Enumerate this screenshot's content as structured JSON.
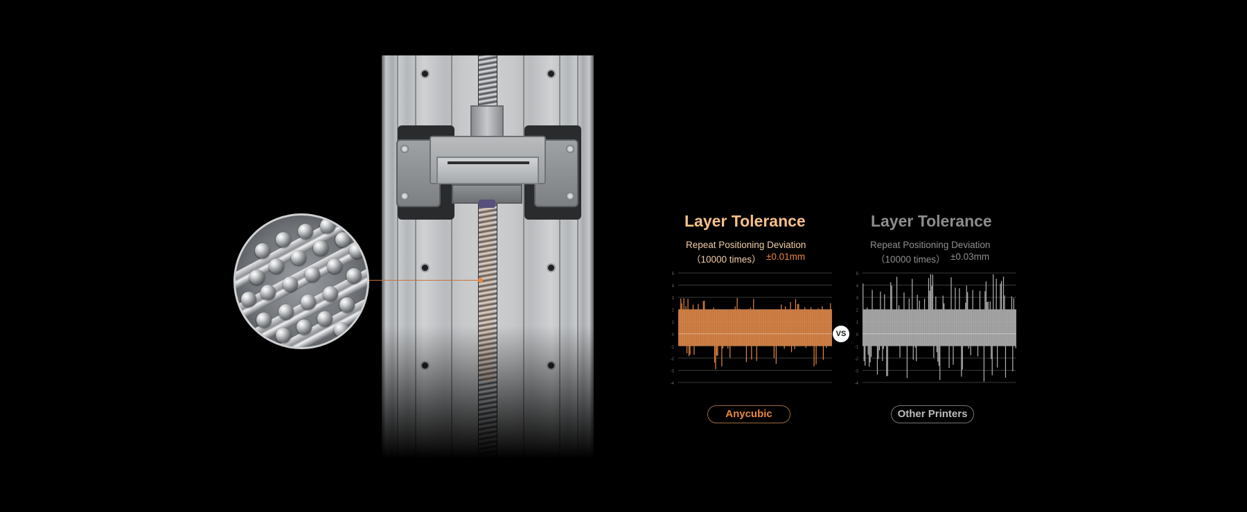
{
  "colors": {
    "background": "#000000",
    "accent": "#e9863d",
    "accent_light": "#f6b56f",
    "gray": "#a8a8a8",
    "gray_light": "#cfcfcf"
  },
  "comparison": {
    "vs_label": "VS"
  },
  "chart_data": [
    {
      "type": "bar",
      "title": "Layer Tolerance",
      "subtitle": "Repeat Positioning Deviation",
      "subtitle_note": "（10000 times）",
      "deviation_value": "±0.01mm",
      "legend_label": "Anycubic",
      "ylim": [
        -4,
        5
      ],
      "yticks": [
        5,
        4,
        3,
        2,
        1,
        0,
        -1,
        -2,
        -3,
        -4
      ],
      "baseline": 0,
      "band": [
        -1,
        2
      ],
      "grid": true,
      "sample_count": 150,
      "color": "#e9863d"
    },
    {
      "type": "bar",
      "title": "Layer Tolerance",
      "subtitle": "Repeat Positioning Deviation",
      "subtitle_note": "（10000 times）",
      "deviation_value": "±0.03mm",
      "legend_label": "Other Printers",
      "ylim": [
        -4,
        5
      ],
      "yticks": [
        5,
        4,
        3,
        2,
        1,
        0,
        -1,
        -2,
        -3,
        -4
      ],
      "baseline": 0,
      "band": [
        -1,
        2
      ],
      "grid": true,
      "sample_count": 150,
      "color": "#b4b4b4"
    }
  ]
}
